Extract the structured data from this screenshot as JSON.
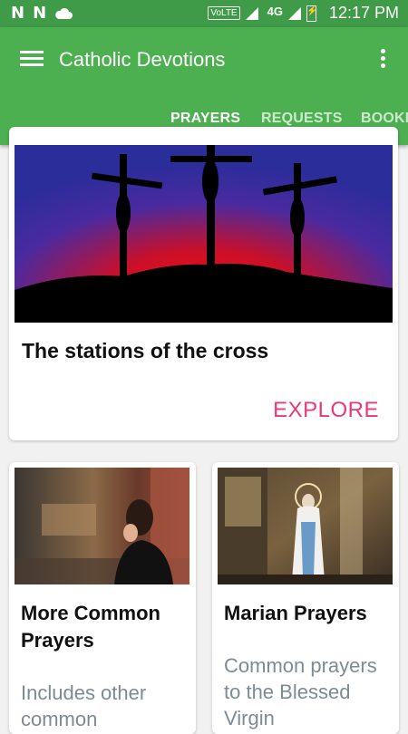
{
  "statusbar": {
    "volte": "VoLTE",
    "network": "4G",
    "time": "12:17 PM"
  },
  "appbar": {
    "title": "Catholic Devotions"
  },
  "tabs": [
    {
      "label": "PRAYERS"
    },
    {
      "label": "REQUESTS"
    },
    {
      "label": "BOOKMARKS"
    }
  ],
  "cards": {
    "stations": {
      "title": "The stations of the cross",
      "action": "EXPLORE"
    },
    "common": {
      "title": "More Common Prayers",
      "description": "Includes other common"
    },
    "marian": {
      "title": "Marian Prayers",
      "description": "Common prayers to the Blessed Virgin"
    }
  },
  "colors": {
    "primary": "#4caf50",
    "statusbar": "#3f9b48",
    "accent": "#e8397a",
    "muted_text": "#7d8b94"
  },
  "icons": [
    "menu-icon",
    "overflow-menu-icon",
    "signal-icon",
    "battery-icon"
  ]
}
